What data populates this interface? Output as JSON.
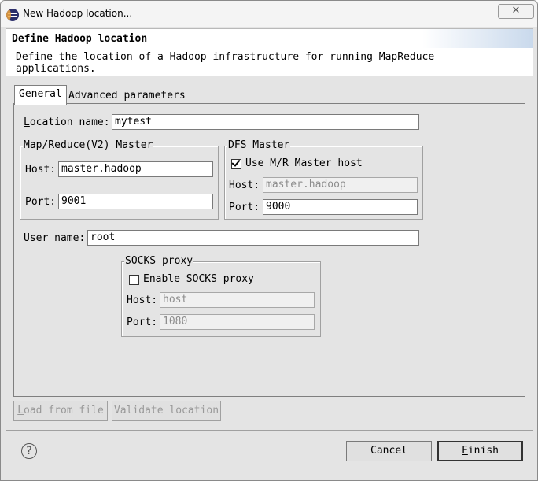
{
  "window": {
    "title": "New Hadoop location...",
    "close_glyph": "✕"
  },
  "header": {
    "title": "Define Hadoop location",
    "description": "Define the location of a Hadoop infrastructure for running MapReduce applications."
  },
  "tabs": [
    {
      "label": "General",
      "active": true
    },
    {
      "label": "Advanced parameters",
      "active": false
    }
  ],
  "general": {
    "location_name": {
      "label_mnemonic": "L",
      "label_rest": "ocation name:",
      "value": "mytest"
    },
    "mr_master": {
      "legend": "Map/Reduce(V2) Master",
      "host_label": "Host:",
      "host_value": "master.hadoop",
      "port_label": "Port:",
      "port_value": "9001"
    },
    "dfs_master": {
      "legend": "DFS Master",
      "use_mr_label": "Use M/R Master host",
      "use_mr_checked": true,
      "host_label": "Host:",
      "host_value": "master.hadoop",
      "port_label": "Port:",
      "port_value": "9000"
    },
    "user_name": {
      "label_mnemonic": "U",
      "label_rest": "ser name:",
      "value": "root"
    },
    "socks_proxy": {
      "legend": "SOCKS proxy",
      "enable_label": "Enable SOCKS proxy",
      "enable_checked": false,
      "host_label": "Host:",
      "host_value": "host",
      "port_label": "Port:",
      "port_value": "1080"
    }
  },
  "actions": {
    "load_mnemonic": "L",
    "load_rest": "oad from file",
    "validate_label": "Validate location"
  },
  "footer": {
    "help_glyph": "?",
    "cancel_label": "Cancel",
    "finish_mnemonic": "F",
    "finish_rest": "inish"
  }
}
